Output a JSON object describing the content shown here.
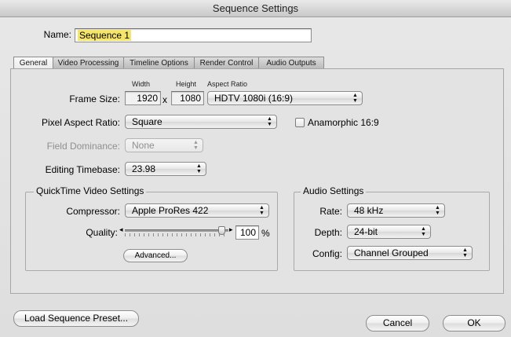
{
  "window": {
    "title": "Sequence Settings"
  },
  "name_row": {
    "label": "Name:",
    "value": "Sequence 1"
  },
  "tabs": [
    {
      "label": "General",
      "active": true
    },
    {
      "label": "Video Processing"
    },
    {
      "label": "Timeline Options"
    },
    {
      "label": "Render Control"
    },
    {
      "label": "Audio Outputs"
    }
  ],
  "general": {
    "col_width": "Width",
    "col_height": "Height",
    "col_aspect": "Aspect Ratio",
    "frame_size_label": "Frame Size:",
    "width_value": "1920",
    "x_sep": "x",
    "height_value": "1080",
    "aspect_ratio_value": "HDTV 1080i (16:9)",
    "pixel_aspect_label": "Pixel Aspect Ratio:",
    "pixel_aspect_value": "Square",
    "anamorphic_label": "Anamorphic 16:9",
    "anamorphic_checked": false,
    "field_dominance_label": "Field Dominance:",
    "field_dominance_value": "None",
    "editing_timebase_label": "Editing Timebase:",
    "editing_timebase_value": "23.98"
  },
  "quicktime": {
    "title": "QuickTime Video Settings",
    "compressor_label": "Compressor:",
    "compressor_value": "Apple ProRes 422",
    "quality_label": "Quality:",
    "quality_value": "100",
    "quality_unit": "%",
    "quality_fraction": 1.0,
    "advanced_label": "Advanced..."
  },
  "audio": {
    "title": "Audio Settings",
    "rate_label": "Rate:",
    "rate_value": "48 kHz",
    "depth_label": "Depth:",
    "depth_value": "24-bit",
    "config_label": "Config:",
    "config_value": "Channel Grouped"
  },
  "footer": {
    "load_preset_label": "Load Sequence Preset...",
    "cancel_label": "Cancel",
    "ok_label": "OK"
  },
  "colors": {
    "selection_highlight": "#f5e56b",
    "window_bg": "#e4e4e4"
  }
}
